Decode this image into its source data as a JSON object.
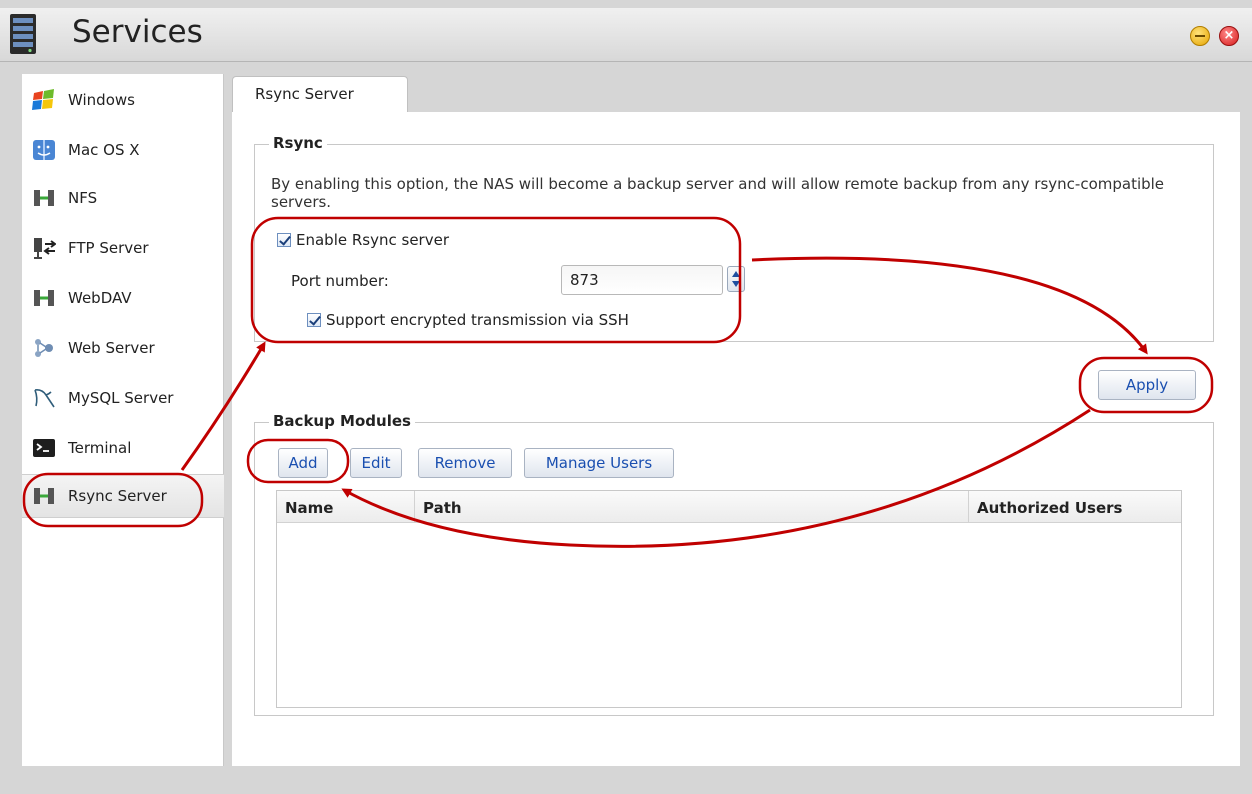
{
  "window": {
    "title": "Services",
    "colors": {
      "accent_red": "#c00000",
      "link_blue": "#1a4fb0"
    }
  },
  "sidebar": {
    "items": [
      {
        "label": "Windows",
        "icon": "windows-flag-icon"
      },
      {
        "label": "Mac OS X",
        "icon": "mac-finder-icon"
      },
      {
        "label": "NFS",
        "icon": "nfs-server-icon"
      },
      {
        "label": "FTP Server",
        "icon": "ftp-server-icon"
      },
      {
        "label": "WebDAV",
        "icon": "webdav-server-icon"
      },
      {
        "label": "Web Server",
        "icon": "web-server-icon"
      },
      {
        "label": "MySQL Server",
        "icon": "mysql-dolphin-icon"
      },
      {
        "label": "Terminal",
        "icon": "terminal-icon"
      },
      {
        "label": "Rsync Server",
        "icon": "rsync-server-icon",
        "selected": true
      }
    ]
  },
  "tabs": [
    {
      "label": "Rsync Server",
      "active": true
    }
  ],
  "rsync": {
    "legend": "Rsync",
    "description": "By enabling this option, the NAS will become a backup server and will allow remote backup from any rsync-compatible servers.",
    "enable_label": "Enable Rsync server",
    "enable_checked": true,
    "port_label": "Port number:",
    "port_value": "873",
    "ssh_label": "Support encrypted transmission via SSH",
    "ssh_checked": true
  },
  "apply_label": "Apply",
  "backup": {
    "legend": "Backup Modules",
    "buttons": {
      "add": "Add",
      "edit": "Edit",
      "remove": "Remove",
      "manage_users": "Manage Users"
    },
    "columns": [
      "Name",
      "Path",
      "Authorized Users"
    ],
    "rows": []
  }
}
